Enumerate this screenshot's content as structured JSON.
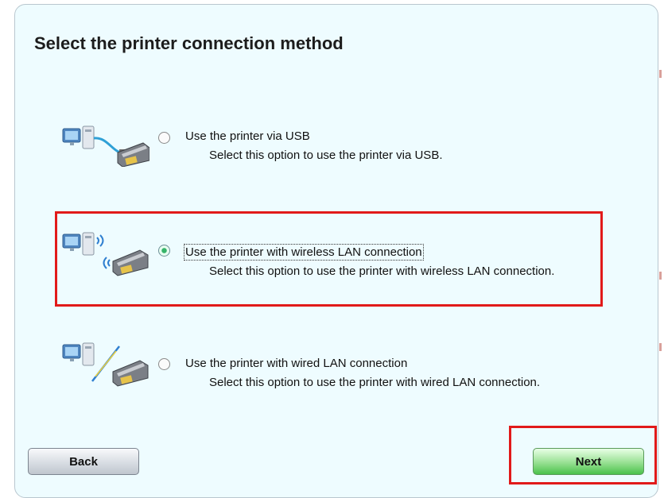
{
  "dialog": {
    "title": "Select the printer connection method"
  },
  "options": [
    {
      "label": "Use the printer via USB",
      "description": "Select this option to use the printer via USB.",
      "icon": "usb-connection-icon",
      "selected": false
    },
    {
      "label": "Use the printer with wireless LAN connection",
      "description": "Select this option to use the printer with wireless LAN connection.",
      "icon": "wireless-lan-connection-icon",
      "selected": true
    },
    {
      "label": "Use the printer with wired LAN connection",
      "description": "Select this option to use the printer with wired LAN connection.",
      "icon": "wired-lan-connection-icon",
      "selected": false
    }
  ],
  "buttons": {
    "back_label": "Back",
    "next_label": "Next"
  },
  "colors": {
    "panel_background": "#eefcff",
    "highlight_border": "#e11a1a",
    "next_button_green": "#4cc24c"
  }
}
